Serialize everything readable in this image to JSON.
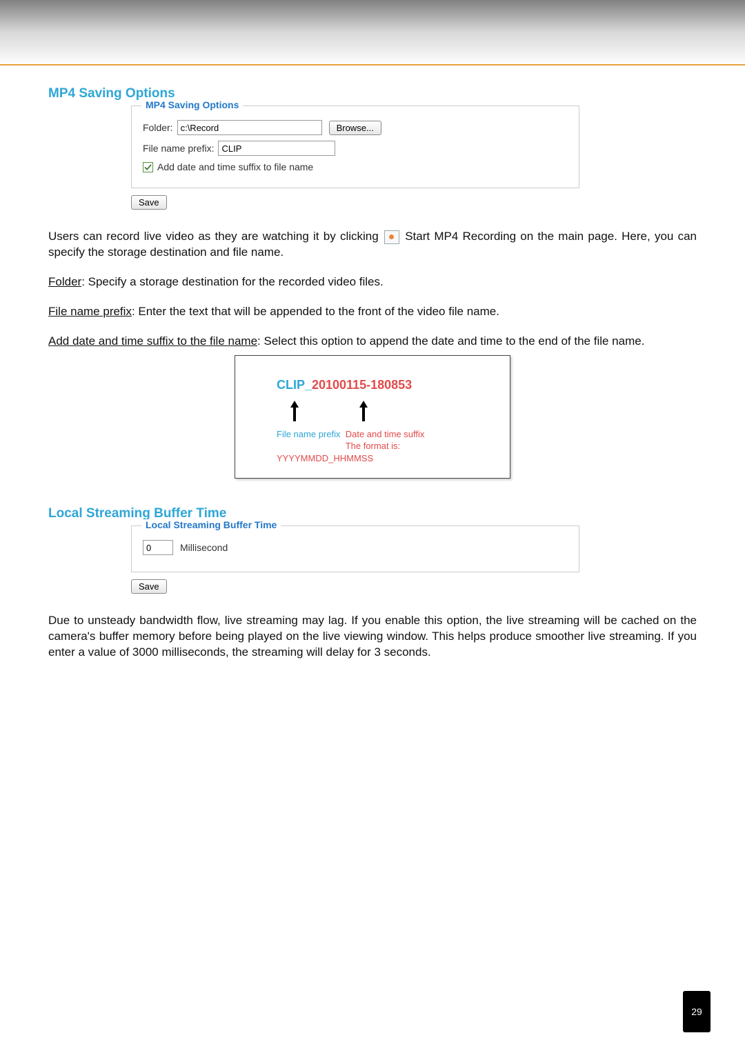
{
  "section1": {
    "heading": "MP4 Saving Options",
    "legend": "MP4 Saving Options",
    "folder_label": "Folder:",
    "folder_value": "c:\\Record",
    "browse_label": "Browse...",
    "prefix_label": "File name prefix:",
    "prefix_value": "CLIP",
    "checkbox_label": "Add date and time suffix to file name",
    "save_label": "Save"
  },
  "paragraphs": {
    "p1a": "Users can record live video as they are watching it by clicking ",
    "p1b": " Start MP4 Recording on the main page. Here, you can specify the storage destination and file name.",
    "p2_label": "Folder",
    "p2_rest": ": Specify a storage destination for the recorded video files.",
    "p3_label": "File name prefix",
    "p3_rest": ": Enter the text that will be appended to the front of the video file name.",
    "p4_label": "Add date and time suffix to the file name",
    "p4_rest": ": Select this option to append the date and time to the end of the file name."
  },
  "example": {
    "clip": "CLIP_",
    "dt": "20100115-180853",
    "prefix_label": "File name prefix",
    "date_label": "Date and time suffix",
    "format_label": "The format is: YYYYMMDD_HHMMSS"
  },
  "section2": {
    "heading": "Local Streaming Buffer Time",
    "legend": "Local Streaming Buffer Time",
    "value": "0",
    "unit": "Millisecond",
    "save_label": "Save",
    "para": "Due to unsteady bandwidth flow, live streaming may lag. If you enable this option, the live streaming will be cached on the camera's buffer memory before being played on the live viewing window. This helps produce smoother live streaming. If you enter a value of 3000 milliseconds, the streaming will delay for 3 seconds."
  },
  "page_number": "29"
}
